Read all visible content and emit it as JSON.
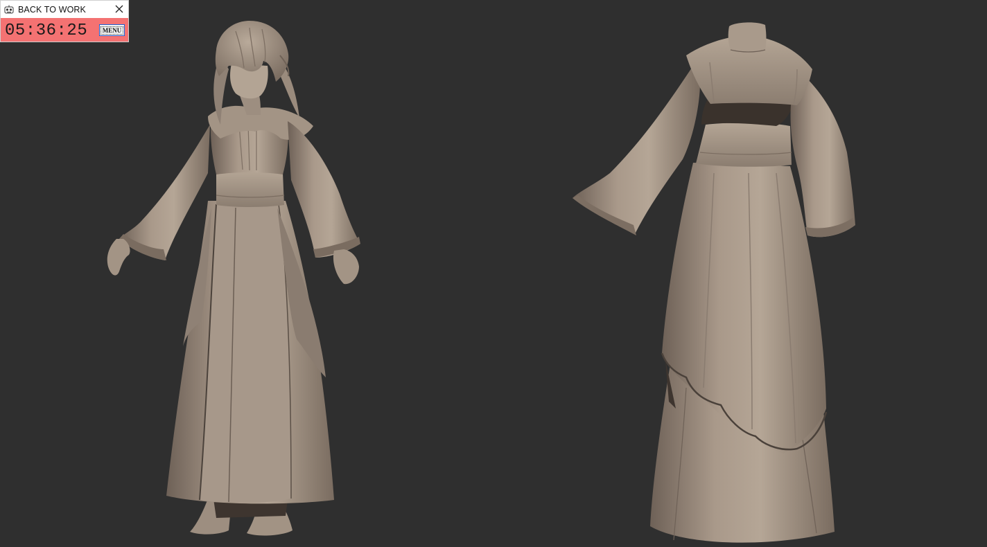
{
  "timer": {
    "title": "BACK TO WORK",
    "time": "05:36:25",
    "menu_label": "MENU",
    "app_icon": "robot-face-icon",
    "close_icon": "close-icon",
    "background_color": "#f47272"
  },
  "viewport": {
    "background_color": "#2f2f2f",
    "models": [
      {
        "name": "figure-front",
        "view": "three-quarter front",
        "material_color": "#a8998a"
      },
      {
        "name": "dress-back",
        "view": "three-quarter back",
        "material_color": "#a8998a"
      }
    ]
  }
}
